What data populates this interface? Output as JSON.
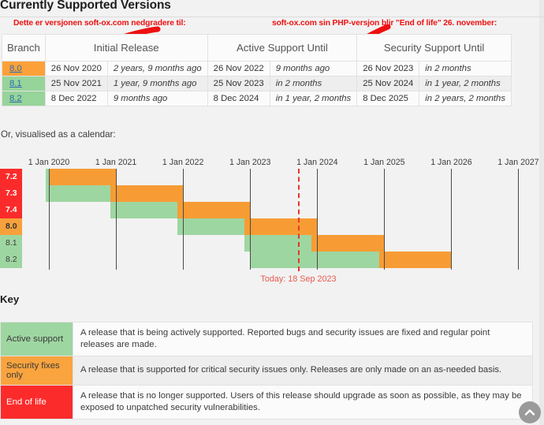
{
  "page": {
    "title": "Currently Supported Versions",
    "calendar_lead": "Or, visualised as a calendar:",
    "key_title": "Key"
  },
  "annotations": {
    "left": "Dette er versjonen soft-ox.com nedgradere til:",
    "right": "soft-ox.com sin PHP-versjon blir \"End of life\" 26. november:",
    "color": "#ee1111"
  },
  "table": {
    "headers": [
      "Branch",
      "Initial Release",
      "Active Support Until",
      "Security Support Until"
    ],
    "rows": [
      {
        "branch": "8.0",
        "branch_status": "security",
        "initial_release_date": "26 Nov 2020",
        "initial_release_rel": "2 years, 9 months ago",
        "active_until_date": "26 Nov 2022",
        "active_until_rel": "9 months ago",
        "security_until_date": "26 Nov 2023",
        "security_until_rel": "in 2 months"
      },
      {
        "branch": "8.1",
        "branch_status": "active",
        "initial_release_date": "25 Nov 2021",
        "initial_release_rel": "1 year, 9 months ago",
        "active_until_date": "25 Nov 2023",
        "active_until_rel": "in 2 months",
        "security_until_date": "25 Nov 2024",
        "security_until_rel": "in 1 year, 2 months"
      },
      {
        "branch": "8.2",
        "branch_status": "active",
        "initial_release_date": "8 Dec 2022",
        "initial_release_rel": "9 months ago",
        "active_until_date": "8 Dec 2024",
        "active_until_rel": "in 1 year, 2 months",
        "security_until_date": "8 Dec 2025",
        "security_until_rel": "in 2 years, 2 months"
      }
    ]
  },
  "chart_data": {
    "type": "bar",
    "title": "Or, visualised as a calendar:",
    "orientation": "horizontal-timeline",
    "xlabel": "",
    "ylabel": "",
    "grid": true,
    "legend_position": "below-as-key-table",
    "x_tick_labels": [
      "1 Jan 2020",
      "1 Jan 2021",
      "1 Jan 2022",
      "1 Jan 2023",
      "1 Jan 2024",
      "1 Jan 2025",
      "1 Jan 2026",
      "1 Jan 2027"
    ],
    "x_tick_values": [
      2020.0,
      2021.0,
      2022.0,
      2023.0,
      2024.0,
      2025.0,
      2026.0,
      2027.0
    ],
    "xlim": [
      2019.6,
      2027.3
    ],
    "categories": [
      "7.2",
      "7.3",
      "7.4",
      "8.0",
      "8.1",
      "8.2"
    ],
    "today": {
      "label": "Today: 18 Sep 2023",
      "value": 2023.72,
      "color": "#e8342b"
    },
    "colors": {
      "active": "#9ed6a1",
      "security": "#f79c34",
      "eol": "#fb2b2b"
    },
    "series": [
      {
        "name": "Active support",
        "key": "active",
        "color": "#9ed6a1",
        "bars": [
          {
            "category": "7.2",
            "start": 2019.95,
            "end": 2020.92
          },
          {
            "category": "7.3",
            "start": 2019.95,
            "end": 2021.92
          },
          {
            "category": "7.4",
            "start": 2020.92,
            "end": 2022.92
          },
          {
            "category": "8.0",
            "start": 2021.92,
            "end": 2023.0
          },
          {
            "category": "8.1",
            "start": 2022.92,
            "end": 2024.0
          },
          {
            "category": "8.2",
            "start": 2023.0,
            "end": 2025.0
          }
        ]
      },
      {
        "name": "Security fixes only",
        "key": "security",
        "color": "#f79c34",
        "bars": [
          {
            "category": "7.2",
            "start": 2020.0,
            "end": 2021.0
          },
          {
            "category": "7.3",
            "start": 2020.92,
            "end": 2022.0
          },
          {
            "category": "7.4",
            "start": 2021.92,
            "end": 2023.0
          },
          {
            "category": "8.0",
            "start": 2022.92,
            "end": 2024.0
          },
          {
            "category": "8.1",
            "start": 2023.92,
            "end": 2025.0
          },
          {
            "category": "8.2",
            "start": 2024.92,
            "end": 2026.0
          }
        ]
      }
    ],
    "category_label_status": {
      "7.2": "eol",
      "7.3": "eol",
      "7.4": "eol",
      "8.0": "security",
      "8.1": "active",
      "8.2": "active"
    }
  },
  "key": {
    "rows": [
      {
        "name": "Active support",
        "status": "active",
        "description": "A release that is being actively supported. Reported bugs and security issues are fixed and regular point releases are made."
      },
      {
        "name": "Security fixes only",
        "status": "security",
        "description": "A release that is supported for critical security issues only. Releases are only made on an as-needed basis."
      },
      {
        "name": "End of life",
        "status": "eol",
        "description": "A release that is no longer supported. Users of this release should upgrade as soon as possible, as they may be exposed to unpatched security vulnerabilities."
      }
    ]
  },
  "scroll_top_button": {
    "icon": "chevron-up-icon"
  }
}
